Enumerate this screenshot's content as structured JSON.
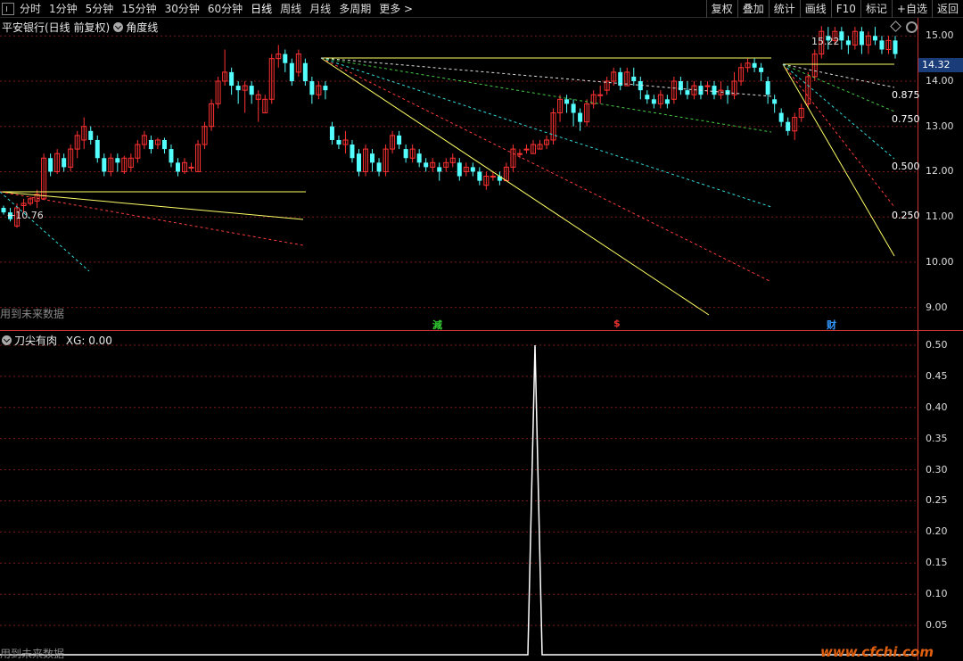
{
  "toolbar": {
    "periods": [
      "分时",
      "1分钟",
      "5分钟",
      "15分钟",
      "30分钟",
      "60分钟",
      "日线",
      "周线",
      "月线",
      "多周期",
      "更多 >"
    ],
    "active": "日线",
    "right_buttons": [
      "复权",
      "叠加",
      "统计",
      "画线",
      "F10",
      "标记",
      "+自选",
      "返回"
    ]
  },
  "main_pane": {
    "title": "平安银行(日线 前复权)",
    "indicator": "角度线",
    "future_note": "用到未来数据",
    "high_label": "15.22",
    "low_label": "←10.76",
    "current_price": "14.32",
    "fan_labels": [
      "0.875",
      "0.750",
      "0.500",
      "0.250"
    ],
    "events": [
      {
        "text": "減",
        "color": "#3c3"
      },
      {
        "text": "$",
        "color": "#e33"
      },
      {
        "text": "财",
        "color": "#39f"
      }
    ],
    "y_ticks": [
      "15.00",
      "14.00",
      "13.00",
      "12.00",
      "11.00",
      "10.00",
      "9.00"
    ]
  },
  "sub_pane": {
    "title": "刀尖有肉",
    "value_label": "XG: 0.00",
    "future_note": "用到未来数据",
    "y_ticks": [
      "0.50",
      "0.45",
      "0.40",
      "0.35",
      "0.30",
      "0.25",
      "0.20",
      "0.15",
      "0.10",
      "0.05"
    ]
  },
  "watermark": "www.cfchi.com",
  "chart_data": {
    "type": "candlestick",
    "ylim": [
      8.5,
      15.4
    ],
    "up_color": "#ff3232",
    "down_color": "#54ffff",
    "candles": [
      [
        11.2,
        11.1,
        11.25,
        11.05
      ],
      [
        11.1,
        10.95,
        11.2,
        10.9
      ],
      [
        10.8,
        11.2,
        11.3,
        10.76
      ],
      [
        11.25,
        11.3,
        11.4,
        11.1
      ],
      [
        11.3,
        11.4,
        11.45,
        11.25
      ],
      [
        11.35,
        11.5,
        11.6,
        11.2
      ],
      [
        11.4,
        12.3,
        12.4,
        11.4
      ],
      [
        12.3,
        12.0,
        12.4,
        11.9
      ],
      [
        12.0,
        12.4,
        12.5,
        11.95
      ],
      [
        12.3,
        12.1,
        12.4,
        12.0
      ],
      [
        12.1,
        12.5,
        12.6,
        12.0
      ],
      [
        12.5,
        12.8,
        12.9,
        12.3
      ],
      [
        12.7,
        13.0,
        13.2,
        12.5
      ],
      [
        12.9,
        12.7,
        13.0,
        12.6
      ],
      [
        12.7,
        12.3,
        12.8,
        12.2
      ],
      [
        12.3,
        12.0,
        12.4,
        11.9
      ],
      [
        12.0,
        12.3,
        12.4,
        11.9
      ],
      [
        12.3,
        12.2,
        12.4,
        12.0
      ],
      [
        12.0,
        12.3,
        12.35,
        11.95
      ],
      [
        12.1,
        12.3,
        12.4,
        12.0
      ],
      [
        12.3,
        12.6,
        12.7,
        12.2
      ],
      [
        12.6,
        12.8,
        12.9,
        12.5
      ],
      [
        12.7,
        12.5,
        12.8,
        12.4
      ],
      [
        12.6,
        12.7,
        12.75,
        12.5
      ],
      [
        12.7,
        12.5,
        12.75,
        12.4
      ],
      [
        12.5,
        12.2,
        12.6,
        12.1
      ],
      [
        12.2,
        12.0,
        12.3,
        11.9
      ],
      [
        12.0,
        12.2,
        12.3,
        11.95
      ],
      [
        12.1,
        12.1,
        12.2,
        12.0
      ],
      [
        12.0,
        12.6,
        12.7,
        12.0
      ],
      [
        12.6,
        13.0,
        13.1,
        12.5
      ],
      [
        13.0,
        13.5,
        13.6,
        12.9
      ],
      [
        13.5,
        14.0,
        14.1,
        13.4
      ],
      [
        14.0,
        14.2,
        14.7,
        13.9
      ],
      [
        14.2,
        13.9,
        14.3,
        13.7
      ],
      [
        13.9,
        13.8,
        14.0,
        13.5
      ],
      [
        13.8,
        13.9,
        14.0,
        13.3
      ],
      [
        13.9,
        13.7,
        14.0,
        13.5
      ],
      [
        13.6,
        13.7,
        13.8,
        13.1
      ],
      [
        13.3,
        13.6,
        13.7,
        13.3
      ],
      [
        13.6,
        14.5,
        14.6,
        13.5
      ],
      [
        14.5,
        14.6,
        14.8,
        14.3
      ],
      [
        14.6,
        14.4,
        14.7,
        14.2
      ],
      [
        14.4,
        14.0,
        14.5,
        13.9
      ],
      [
        14.2,
        14.6,
        14.7,
        14.1
      ],
      [
        14.4,
        14.0,
        14.5,
        13.9
      ],
      [
        14.0,
        13.7,
        14.1,
        13.5
      ],
      [
        13.7,
        13.9,
        14.0,
        13.6
      ],
      [
        13.9,
        13.8,
        14.0,
        13.6
      ],
      [
        13.0,
        12.7,
        13.1,
        12.6
      ],
      [
        12.7,
        12.6,
        12.8,
        12.5
      ],
      [
        12.6,
        12.7,
        12.9,
        12.4
      ],
      [
        12.6,
        12.3,
        12.7,
        12.2
      ],
      [
        12.4,
        12.0,
        12.5,
        11.9
      ],
      [
        12.0,
        12.5,
        12.6,
        11.9
      ],
      [
        12.4,
        12.2,
        12.5,
        12.0
      ],
      [
        12.2,
        12.0,
        12.3,
        11.9
      ],
      [
        12.0,
        12.5,
        12.6,
        11.9
      ],
      [
        12.5,
        12.8,
        12.9,
        12.4
      ],
      [
        12.8,
        12.6,
        12.9,
        12.5
      ],
      [
        12.5,
        12.3,
        12.6,
        12.2
      ],
      [
        12.3,
        12.5,
        12.6,
        12.2
      ],
      [
        12.4,
        12.2,
        12.5,
        12.1
      ],
      [
        12.2,
        12.1,
        12.3,
        12.0
      ],
      [
        12.1,
        12.2,
        12.3,
        12.0
      ],
      [
        12.1,
        12.0,
        12.2,
        11.8
      ],
      [
        12.1,
        12.2,
        12.3,
        12.0
      ],
      [
        12.2,
        12.3,
        12.4,
        12.1
      ],
      [
        12.2,
        11.9,
        12.3,
        11.8
      ],
      [
        12.0,
        12.1,
        12.2,
        11.9
      ],
      [
        12.1,
        12.0,
        12.2,
        11.9
      ],
      [
        12.0,
        11.8,
        12.1,
        11.7
      ],
      [
        11.7,
        11.9,
        12.0,
        11.6
      ],
      [
        11.9,
        11.9,
        12.0,
        11.8
      ],
      [
        11.9,
        11.8,
        12.0,
        11.7
      ],
      [
        11.8,
        12.1,
        12.2,
        11.8
      ],
      [
        12.1,
        12.5,
        12.6,
        12.0
      ],
      [
        12.4,
        12.4,
        12.5,
        12.3
      ],
      [
        12.5,
        12.5,
        12.6,
        12.4
      ],
      [
        12.4,
        12.6,
        12.7,
        12.4
      ],
      [
        12.5,
        12.6,
        12.7,
        12.5
      ],
      [
        12.6,
        12.7,
        12.8,
        12.5
      ],
      [
        12.7,
        13.3,
        13.4,
        12.6
      ],
      [
        13.3,
        13.6,
        13.7,
        13.1
      ],
      [
        13.6,
        13.5,
        13.7,
        13.3
      ],
      [
        13.5,
        13.3,
        13.6,
        13.0
      ],
      [
        13.3,
        13.1,
        13.4,
        12.9
      ],
      [
        13.1,
        13.5,
        13.6,
        13.0
      ],
      [
        13.5,
        13.7,
        13.8,
        13.4
      ],
      [
        13.7,
        13.7,
        13.9,
        13.5
      ],
      [
        13.8,
        14.0,
        14.1,
        13.7
      ],
      [
        14.0,
        14.2,
        14.3,
        13.9
      ],
      [
        14.2,
        13.9,
        14.3,
        13.8
      ],
      [
        13.9,
        14.2,
        14.3,
        13.9
      ],
      [
        14.1,
        14.0,
        14.3,
        13.9
      ],
      [
        14.0,
        13.8,
        14.1,
        13.6
      ],
      [
        13.7,
        13.6,
        13.8,
        13.5
      ],
      [
        13.6,
        13.5,
        13.7,
        13.4
      ],
      [
        13.5,
        13.7,
        13.8,
        13.4
      ],
      [
        13.6,
        13.5,
        13.7,
        13.4
      ],
      [
        13.6,
        14.0,
        14.1,
        13.5
      ],
      [
        14.0,
        13.8,
        14.1,
        13.7
      ],
      [
        13.8,
        13.7,
        14.0,
        13.6
      ],
      [
        13.7,
        13.9,
        14.0,
        13.6
      ],
      [
        13.9,
        13.7,
        14.0,
        13.6
      ],
      [
        13.9,
        13.9,
        14.0,
        13.7
      ],
      [
        13.9,
        13.7,
        14.0,
        13.6
      ],
      [
        13.7,
        13.8,
        14.0,
        13.6
      ],
      [
        13.8,
        13.7,
        13.9,
        13.5
      ],
      [
        13.7,
        14.0,
        14.2,
        13.6
      ],
      [
        14.0,
        14.3,
        14.4,
        13.9
      ],
      [
        14.3,
        14.4,
        14.5,
        14.2
      ],
      [
        14.4,
        14.3,
        14.5,
        14.2
      ],
      [
        14.3,
        14.2,
        14.4,
        14.0
      ],
      [
        14.0,
        13.7,
        14.1,
        13.5
      ],
      [
        13.6,
        13.5,
        13.7,
        13.3
      ],
      [
        13.3,
        13.1,
        13.4,
        13.0
      ],
      [
        13.1,
        12.9,
        13.2,
        12.8
      ],
      [
        12.9,
        13.2,
        13.3,
        12.7
      ],
      [
        13.2,
        13.4,
        13.5,
        13.1
      ],
      [
        13.5,
        14.1,
        14.2,
        13.4
      ],
      [
        14.1,
        14.6,
        14.7,
        14.0
      ],
      [
        14.6,
        15.1,
        15.22,
        14.5
      ],
      [
        15.0,
        14.9,
        15.2,
        14.7
      ],
      [
        14.9,
        15.1,
        15.2,
        14.8
      ],
      [
        15.1,
        14.9,
        15.2,
        14.7
      ],
      [
        14.9,
        14.8,
        15.0,
        14.6
      ],
      [
        14.8,
        15.1,
        15.2,
        14.7
      ],
      [
        15.1,
        14.8,
        15.2,
        14.6
      ],
      [
        14.8,
        15.0,
        15.1,
        14.6
      ],
      [
        15.0,
        14.9,
        15.2,
        14.8
      ],
      [
        14.9,
        14.7,
        15.0,
        14.6
      ],
      [
        14.7,
        14.9,
        15.0,
        14.6
      ],
      [
        14.9,
        14.6,
        15.0,
        14.5
      ]
    ],
    "indicator": {
      "name": "XG",
      "peak_value": 0.5,
      "ylim": [
        0,
        0.52
      ]
    }
  }
}
